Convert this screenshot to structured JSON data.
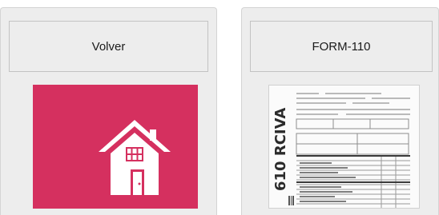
{
  "left_card": {
    "button_label": "Volver",
    "tile_icon": "home-icon",
    "tile_color": "#d5305f"
  },
  "right_card": {
    "button_label": "FORM-110",
    "thumbnail_vertical_text": "610  RCIVA"
  }
}
